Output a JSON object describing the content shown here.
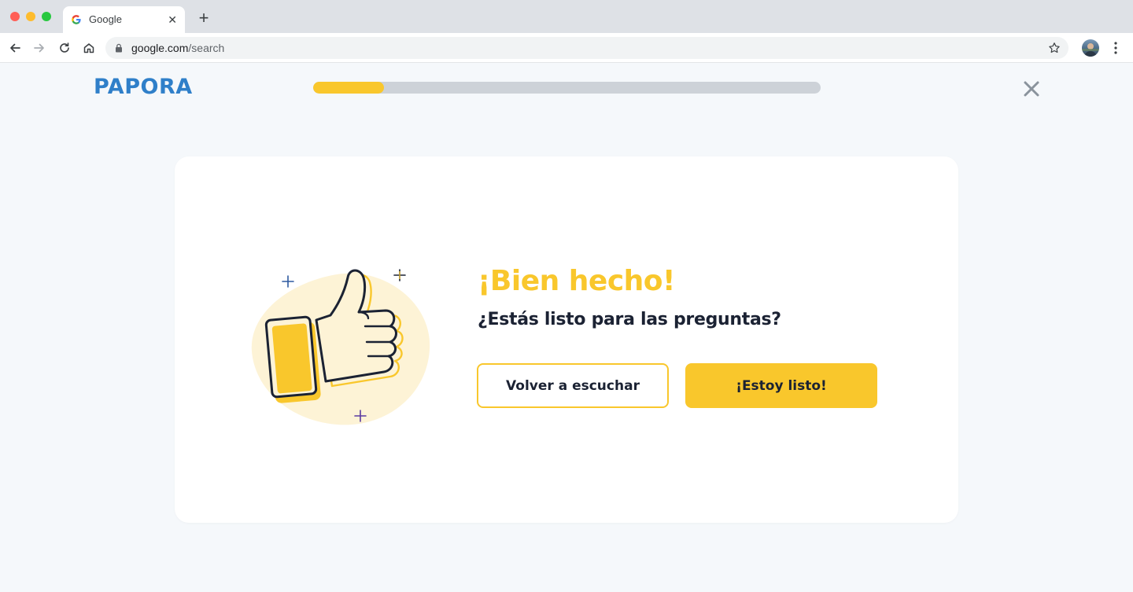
{
  "browser": {
    "tab_title": "Google",
    "url_domain": "google.com",
    "url_path": "/search",
    "icons": [
      "back-icon",
      "forward-icon",
      "reload-icon",
      "home-icon",
      "lock-icon",
      "star-icon",
      "profile-avatar",
      "menu-icon"
    ]
  },
  "header": {
    "logo": "PAPORA",
    "progress_fraction": 0.14,
    "close_icon": "close-icon"
  },
  "card": {
    "headline": "¡Bien hecho!",
    "subline": "¿Estás listo para las preguntas?",
    "secondary_button": "Volver a escuchar",
    "primary_button": "¡Estoy listo!",
    "illustration": "thumbs-up-icon"
  },
  "colors": {
    "accent_yellow": "#f9c72c",
    "logo_blue": "#2f7fc9",
    "text_dark": "#1b2233",
    "track_gray": "#cdd2d8"
  }
}
